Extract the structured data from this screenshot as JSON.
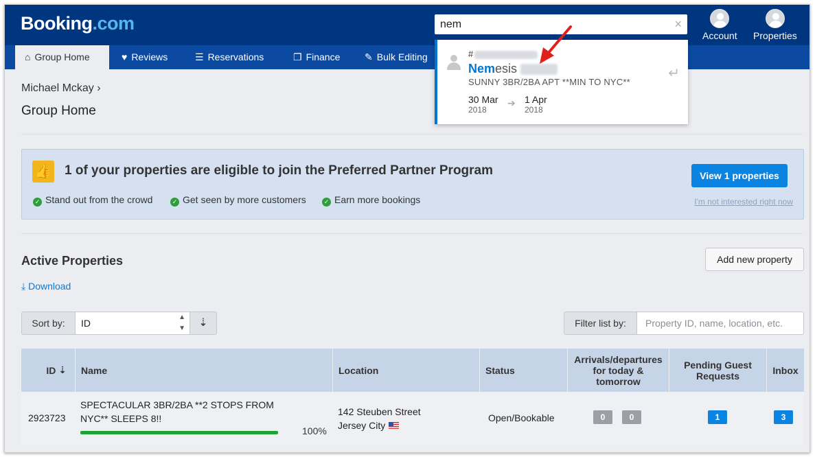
{
  "header": {
    "logo_main": "Booking",
    "logo_tld": ".com",
    "search_value": "nem",
    "search_clear": "×",
    "account_label": "Account",
    "properties_label": "Properties"
  },
  "nav": [
    {
      "label": "Group Home",
      "icon": "home-icon",
      "glyph": "⌂"
    },
    {
      "label": "Reviews",
      "icon": "heart-icon",
      "glyph": "♥"
    },
    {
      "label": "Reservations",
      "icon": "list-icon",
      "glyph": "☰"
    },
    {
      "label": "Finance",
      "icon": "document-icon",
      "glyph": "❐"
    },
    {
      "label": "Bulk Editing",
      "icon": "pencil-icon",
      "glyph": "✎"
    }
  ],
  "search_dropdown": {
    "hash": "#",
    "name_highlight": "Nem",
    "name_rest": "esis",
    "subtitle": "SUNNY 3BR/2BA APT **MIN TO NYC**",
    "from_date": "30 Mar",
    "from_year": "2018",
    "to_date": "1 Apr",
    "to_year": "2018"
  },
  "breadcrumb": "Michael Mckay ›",
  "page_title": "Group Home",
  "banner": {
    "title_prefix": "1 of your properties are eligible to join the ",
    "title_bold": "Preferred Partner Program",
    "bullets": [
      "Stand out from the crowd",
      "Get seen by more customers",
      "Earn more bookings"
    ],
    "view_button": "View 1 properties",
    "not_interested": "I'm not interested right now"
  },
  "active": {
    "title": "Active Properties",
    "add_button": "Add new property",
    "download": "Download",
    "sort_label": "Sort by:",
    "sort_value": "ID",
    "filter_label": "Filter list by:",
    "filter_placeholder": "Property ID, name, location, etc."
  },
  "table": {
    "headers": {
      "id": "ID",
      "name": "Name",
      "location": "Location",
      "status": "Status",
      "arrivals": "Arrivals/departures for today & tomorrow",
      "pending": "Pending Guest Requests",
      "inbox": "Inbox"
    },
    "rows": [
      {
        "id": "2923723",
        "name": "SPECTACULAR 3BR/2BA **2 STOPS FROM NYC** SLEEPS 8!!",
        "completion": "100%",
        "completion_fraction": 1.0,
        "location_line1": "142 Steuben Street",
        "location_line2": "Jersey City",
        "status": "Open/Bookable",
        "arrivals_today": "0",
        "arrivals_tomorrow": "0",
        "pending": "1",
        "inbox": "3"
      }
    ]
  },
  "colors": {
    "brand": "#003580",
    "nav": "#0b4aa0",
    "accent": "#0a84e0",
    "success": "#1ea232"
  }
}
